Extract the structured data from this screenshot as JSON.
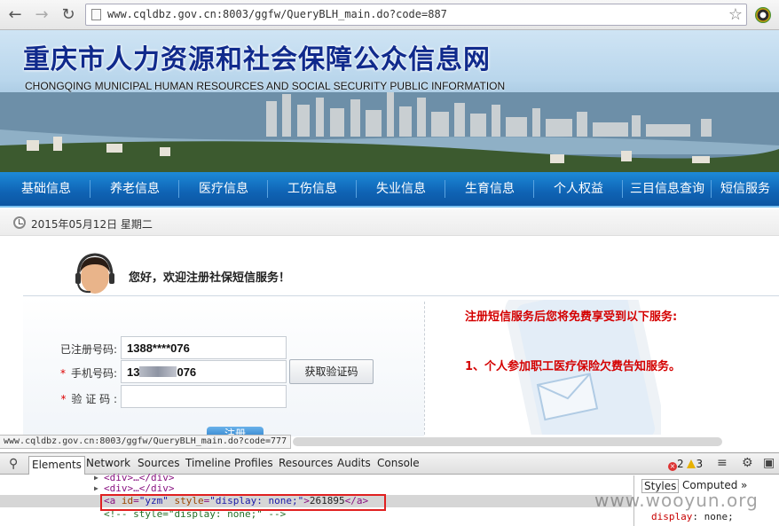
{
  "browser": {
    "url": "www.cqldbz.gov.cn:8003/ggfw/QueryBLH_main.do?code=887",
    "status_url": "www.cqldbz.gov.cn:8003/ggfw/QueryBLH_main.do?code=777"
  },
  "banner": {
    "title_cn": "重庆市人力资源和社会保障公众信息网",
    "title_en": "CHONGQING MUNICIPAL HUMAN RESOURCES AND SOCIAL SECURITY PUBLIC INFORMATION"
  },
  "nav": {
    "items": [
      "基础信息",
      "养老信息",
      "医疗信息",
      "工伤信息",
      "失业信息",
      "生育信息",
      "个人权益",
      "三目信息查询",
      "短信服务"
    ]
  },
  "date": "2015年05月12日 星期二",
  "main": {
    "welcome": "您好，欢迎注册社保短信服务！",
    "registered_label": "已注册号码:",
    "registered_value": "1388****076",
    "phone_label": "手机号码:",
    "phone_prefix": "13",
    "phone_suffix": "076",
    "code_label": "验 证 码 :",
    "get_code_button": "获取验证码",
    "submit_button": "注册",
    "required_mark": "*",
    "notice_title": "注册短信服务后您将免费享受到以下服务:",
    "notice_item1": "1、个人参加职工医疗保险欠费告知服务。"
  },
  "devtools": {
    "tabs": [
      "Elements",
      "Network",
      "Sources",
      "Timeline",
      "Profiles",
      "Resources",
      "Audits",
      "Console"
    ],
    "errors": "2",
    "warnings": "3",
    "code": {
      "line1": "<div>…</div>",
      "line2": "<div>…</div>",
      "line3_open": "<a ",
      "line3_attr1": "id",
      "line3_val1": "\"yzm\"",
      "line3_attr2": "style",
      "line3_val2": "\"display: none;\"",
      "line3_text": "261895",
      "line3_close": "</a>",
      "line4": "<!-- style=\"display: none;\" -->"
    },
    "styles_tabs": [
      "Styles",
      "Computed"
    ],
    "style_prop": "display",
    "style_value": "none;"
  },
  "watermark": "www.wooyun.org",
  "colors": {
    "nav_bg": "#0f63b4",
    "notice_red": "#d40000",
    "highlight_box": "#e02020"
  }
}
